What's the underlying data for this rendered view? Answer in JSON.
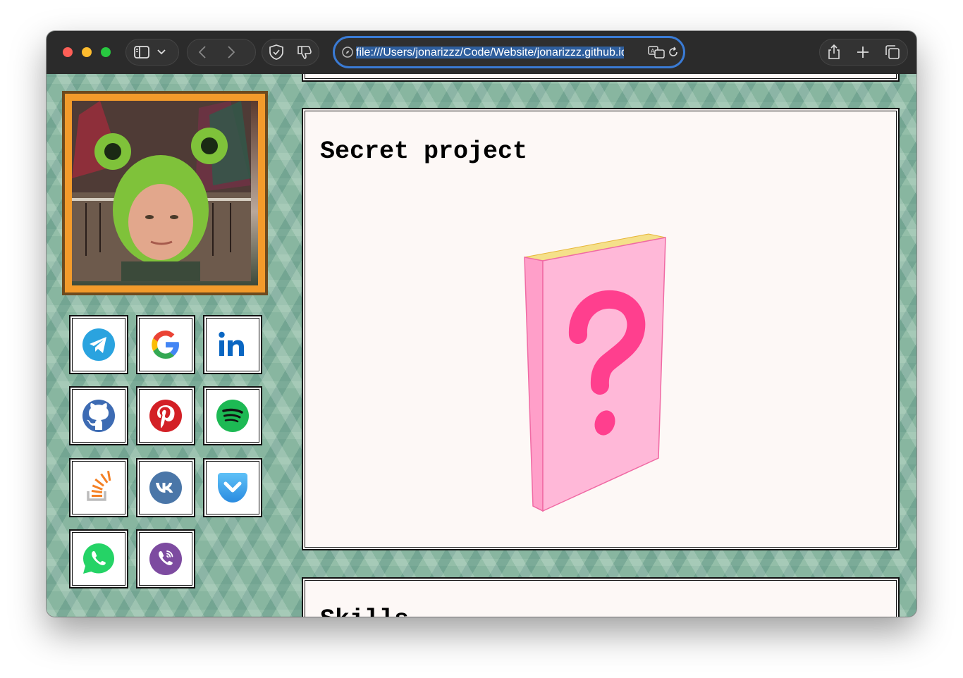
{
  "browser": {
    "url": "file:///Users/jonarizzz/Code/Website/jonarizzz.github.io/index.html",
    "toolbar_icons": [
      "sidebar-icon",
      "chevron-down-icon",
      "back-icon",
      "forward-icon",
      "shield-icon",
      "thumbs-down-icon",
      "share-icon",
      "plus-icon",
      "tabs-icon"
    ],
    "url_icons": [
      "compass-icon",
      "translate-icon",
      "reload-icon"
    ]
  },
  "sidebar": {
    "photo": "profile-photo",
    "socials": [
      {
        "name": "telegram",
        "icon": "telegram-icon",
        "color": "#2aa3df"
      },
      {
        "name": "google",
        "icon": "google-icon",
        "color": "#4285f4"
      },
      {
        "name": "linkedin",
        "icon": "linkedin-icon",
        "color": "#0a66c2"
      },
      {
        "name": "github",
        "icon": "github-icon",
        "color": "#3d6bb3"
      },
      {
        "name": "pinterest",
        "icon": "pinterest-icon",
        "color": "#d32026"
      },
      {
        "name": "spotify",
        "icon": "spotify-icon",
        "color": "#1db954"
      },
      {
        "name": "stackoverflow",
        "icon": "stackoverflow-icon",
        "color": "#f48024"
      },
      {
        "name": "vk",
        "icon": "vk-icon",
        "color": "#4a76a8"
      },
      {
        "name": "pocket",
        "icon": "pocket-icon",
        "color": "#3fa9f5"
      },
      {
        "name": "whatsapp",
        "icon": "whatsapp-icon",
        "color": "#25d366"
      },
      {
        "name": "viber",
        "icon": "viber-icon",
        "color": "#7d4ba0"
      }
    ]
  },
  "main": {
    "sections": [
      {
        "title": "Secret project",
        "image": "mystery-book-icon"
      },
      {
        "title": "Skills"
      }
    ]
  },
  "colors": {
    "frame": "#f39b2b",
    "card": "#fdf8f6",
    "book": "#ffb8d8",
    "question_mark": "#ff3f8e"
  }
}
